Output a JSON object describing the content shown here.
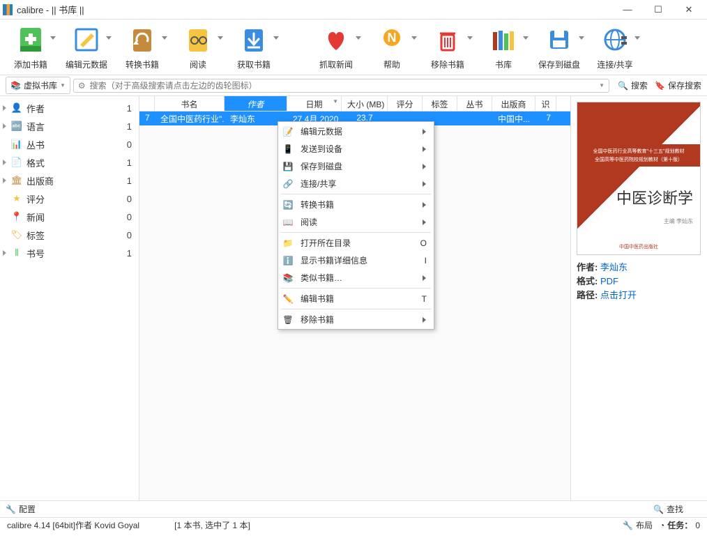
{
  "window": {
    "title": "calibre - || 书库 ||"
  },
  "toolbar": [
    {
      "id": "add",
      "label": "添加书籍",
      "drop": true
    },
    {
      "id": "meta",
      "label": "编辑元数据",
      "drop": true
    },
    {
      "id": "convert",
      "label": "转换书籍",
      "drop": true
    },
    {
      "id": "read",
      "label": "阅读",
      "drop": true
    },
    {
      "id": "fetch",
      "label": "获取书籍",
      "drop": true
    },
    {
      "id": "news",
      "label": "抓取新闻",
      "drop": true
    },
    {
      "id": "help",
      "label": "帮助",
      "drop": true
    },
    {
      "id": "remove",
      "label": "移除书籍",
      "drop": true
    },
    {
      "id": "lib",
      "label": "书库",
      "drop": true
    },
    {
      "id": "save",
      "label": "保存到磁盘",
      "drop": true
    },
    {
      "id": "connect",
      "label": "连接/共享",
      "drop": true
    }
  ],
  "search": {
    "vlib_label": "虚拟书库",
    "placeholder": "搜索（对于高级搜索请点击左边的齿轮图标）",
    "search_btn": "搜索",
    "save_btn": "保存搜索"
  },
  "sidebar": [
    {
      "icon": "author",
      "label": "作者",
      "count": "1",
      "tri": true
    },
    {
      "icon": "lang",
      "label": "语言",
      "count": "1",
      "tri": true
    },
    {
      "icon": "series",
      "label": "丛书",
      "count": "0",
      "tri": false
    },
    {
      "icon": "format",
      "label": "格式",
      "count": "1",
      "tri": true
    },
    {
      "icon": "publisher",
      "label": "出版商",
      "count": "1",
      "tri": true
    },
    {
      "icon": "rating",
      "label": "评分",
      "count": "0",
      "tri": false
    },
    {
      "icon": "news",
      "label": "新闻",
      "count": "0",
      "tri": false
    },
    {
      "icon": "tag",
      "label": "标签",
      "count": "0",
      "tri": false
    },
    {
      "icon": "id",
      "label": "书号",
      "count": "1",
      "tri": true
    }
  ],
  "columns": [
    "书名",
    "作者",
    "日期",
    "大小 (MB)",
    "评分",
    "标签",
    "丛书",
    "出版商",
    "识"
  ],
  "books": [
    {
      "idx": "7",
      "title": "全国中医药行业\"...",
      "author": "李灿东",
      "date": "27 4月 2020",
      "size": "23.7",
      "rating": "",
      "tag": "",
      "series": "",
      "publisher": "中国中...",
      "id": "7"
    }
  ],
  "context_menu": [
    {
      "icon": "meta",
      "label": "编辑元数据",
      "sub": true
    },
    {
      "icon": "device",
      "label": "发送到设备",
      "sub": true
    },
    {
      "icon": "disk",
      "label": "保存到磁盘",
      "sub": true
    },
    {
      "icon": "share",
      "label": "连接/共享",
      "sub": true
    },
    {
      "hr": true
    },
    {
      "icon": "convert",
      "label": "转换书籍",
      "sub": true
    },
    {
      "icon": "read",
      "label": "阅读",
      "sub": true
    },
    {
      "hr": true
    },
    {
      "icon": "folder",
      "label": "打开所在目录",
      "shortcut": "O"
    },
    {
      "icon": "info",
      "label": "显示书籍详细信息",
      "shortcut": "I"
    },
    {
      "icon": "similar",
      "label": "类似书籍…",
      "sub": true
    },
    {
      "hr": true
    },
    {
      "icon": "edit",
      "label": "编辑书籍",
      "shortcut": "T"
    },
    {
      "hr": true
    },
    {
      "icon": "remove",
      "label": "移除书籍",
      "sub": true
    }
  ],
  "details": {
    "cover_band1": "全国中医药行业高等教育\"十三五\"规划教材",
    "cover_band2": "全国高等中医药院校规划教材（第十版）",
    "cover_title": "中医诊断学",
    "cover_editor": "主编  李灿东",
    "cover_pub": "中国中医药出版社",
    "author_label": "作者:",
    "author": "李灿东",
    "format_label": "格式:",
    "format": "PDF",
    "path_label": "路径:",
    "path": "点击打开"
  },
  "bottom": {
    "config": "配置",
    "find": "查找"
  },
  "status": {
    "left": "calibre 4.14 [64bit]作者 Kovid Goyal",
    "center": "[1 本书, 选中了 1 本]",
    "layout": "布局",
    "jobs_label": "任务：",
    "jobs": "0"
  }
}
